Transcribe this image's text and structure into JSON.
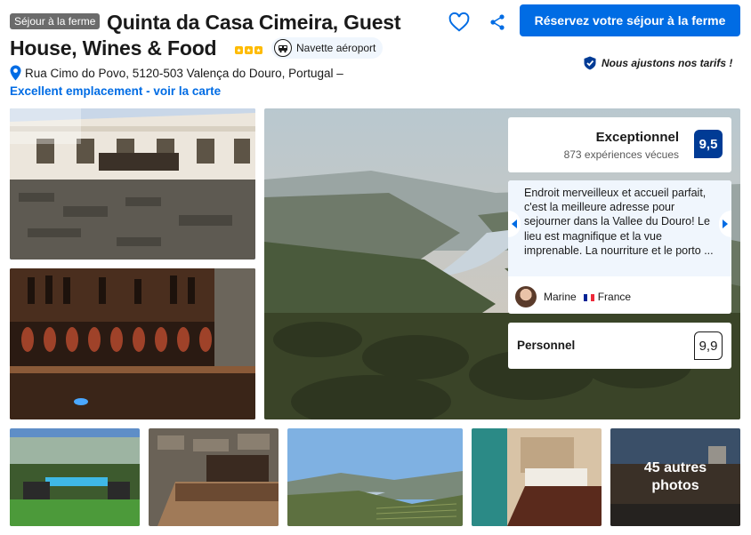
{
  "header": {
    "type_badge": "Séjour à la ferme",
    "title_line1": "Quinta da Casa Cimeira, Guest",
    "title_line2": "House, Wines & Food",
    "star_rating": 3,
    "shuttle_label": "Navette aéroport",
    "reserve_button": "Réservez votre séjour à la ferme",
    "price_match": "Nous ajustons nos tarifs !"
  },
  "address": {
    "text": "Rua Cimo do Povo, 5120-503 Valença do Douro, Portugal –",
    "map_link": "Excellent emplacement - voir la carte"
  },
  "score": {
    "label": "Exceptionnel",
    "count": "873 expériences vécues",
    "value": "9,5"
  },
  "review": {
    "text": "Endroit merveilleux et accueil parfait, c'est la meilleure adresse pour sejourner dans la Vallee du Douro! Le lieu est magnifique et la vue imprenable. La nourriture et le porto ...",
    "reviewer": "Marine",
    "country": "France"
  },
  "staff": {
    "label": "Personnel",
    "value": "9,9"
  },
  "gallery": {
    "more_label": "45 autres photos"
  },
  "colors": {
    "brand_blue": "#006ce4",
    "score_navy": "#003b95",
    "star_yellow": "#febb02"
  }
}
